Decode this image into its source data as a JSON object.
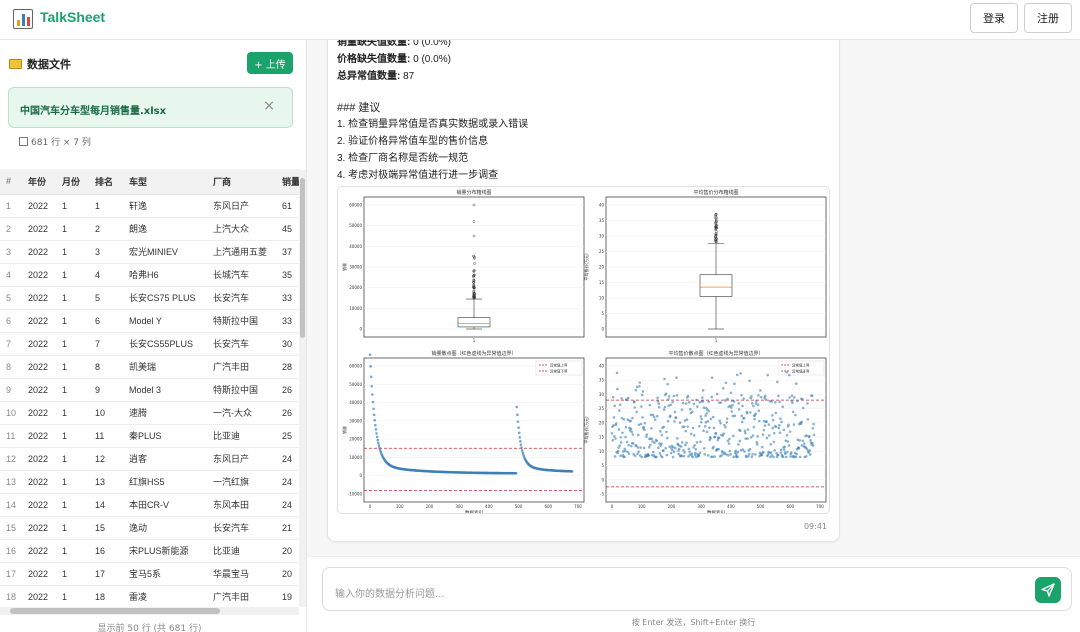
{
  "header": {
    "title": "TalkSheet",
    "login_label": "登录",
    "register_label": "注册",
    "brand_color": "#1aa36b"
  },
  "sidebar": {
    "heading": "数据文件",
    "upload_label": "+ 上传",
    "file": {
      "name": "中国汽车分车型每月销售量.xlsx",
      "close_icon": "×"
    },
    "rows_info": "681 行 × 7 列",
    "table": {
      "columns": [
        "#",
        "年份",
        "月份",
        "排名",
        "车型",
        "厂商",
        "销量"
      ],
      "rows": [
        [
          "1",
          "2022",
          "1",
          "1",
          "轩逸",
          "东风日产",
          "61"
        ],
        [
          "2",
          "2022",
          "1",
          "2",
          "朗逸",
          "上汽大众",
          "45"
        ],
        [
          "3",
          "2022",
          "1",
          "3",
          "宏光MINIEV",
          "上汽通用五菱",
          "37"
        ],
        [
          "4",
          "2022",
          "1",
          "4",
          "哈弗H6",
          "长城汽车",
          "35"
        ],
        [
          "5",
          "2022",
          "1",
          "5",
          "长安CS75 PLUS",
          "长安汽车",
          "33"
        ],
        [
          "6",
          "2022",
          "1",
          "6",
          "Model Y",
          "特斯拉中国",
          "33"
        ],
        [
          "7",
          "2022",
          "1",
          "7",
          "长安CS55PLUS",
          "长安汽车",
          "30"
        ],
        [
          "8",
          "2022",
          "1",
          "8",
          "凯美瑞",
          "广汽丰田",
          "28"
        ],
        [
          "9",
          "2022",
          "1",
          "9",
          "Model 3",
          "特斯拉中国",
          "26"
        ],
        [
          "10",
          "2022",
          "1",
          "10",
          "速腾",
          "一汽-大众",
          "26"
        ],
        [
          "11",
          "2022",
          "1",
          "11",
          "秦PLUS",
          "比亚迪",
          "25"
        ],
        [
          "12",
          "2022",
          "1",
          "12",
          "逍客",
          "东风日产",
          "24"
        ],
        [
          "13",
          "2022",
          "1",
          "13",
          "红旗HS5",
          "一汽红旗",
          "24"
        ],
        [
          "14",
          "2022",
          "1",
          "14",
          "本田CR-V",
          "东风本田",
          "24"
        ],
        [
          "15",
          "2022",
          "1",
          "15",
          "逸动",
          "长安汽车",
          "21"
        ],
        [
          "16",
          "2022",
          "1",
          "16",
          "宋PLUS新能源",
          "比亚迪",
          "20"
        ],
        [
          "17",
          "2022",
          "1",
          "17",
          "宝马5系",
          "华晨宝马",
          "20"
        ],
        [
          "18",
          "2022",
          "1",
          "18",
          "雷凌",
          "广汽丰田",
          "19"
        ]
      ]
    },
    "footer": "显示前 50 行 (共 681 行)"
  },
  "message": {
    "lines": [
      {
        "b": "销量缺失值数量:",
        "t": " 0 (0.0%)"
      },
      {
        "b": "价格缺失值数量:",
        "t": " 0 (0.0%)"
      },
      {
        "b": "总异常值数量:",
        "t": " 87"
      },
      {
        "b": "",
        "t": ""
      },
      {
        "b": "",
        "t": "### 建议"
      },
      {
        "b": "",
        "t": "1. 检查销量异常值是否真实数据或录入错误"
      },
      {
        "b": "",
        "t": "2. 验证价格异常值车型的售价信息"
      },
      {
        "b": "",
        "t": "3. 检查厂商名称是否统一规范"
      },
      {
        "b": "",
        "t": "4. 考虑对极端异常值进行进一步调查"
      }
    ],
    "time": "09:41"
  },
  "figure": {
    "panels": [
      {
        "title": "销量分布箱线图",
        "ylabel": "销量",
        "y_ticks": [
          "0",
          "10000",
          "20000",
          "30000",
          "40000",
          "50000",
          "60000"
        ],
        "x_ticks": [
          "1"
        ]
      },
      {
        "title": "平均售价分布箱线图",
        "ylabel": "平均售价(万元)",
        "y_ticks": [
          "0",
          "5",
          "10",
          "15",
          "20",
          "25",
          "30",
          "35",
          "40"
        ],
        "x_ticks": [
          "1"
        ]
      },
      {
        "title": "销量散点图（红色虚线为异常值边界）",
        "ylabel": "销量",
        "xlabel": "数据索引",
        "y_ticks": [
          "-10000",
          "0",
          "10000",
          "20000",
          "30000",
          "40000",
          "50000",
          "60000"
        ],
        "x_ticks": [
          "0",
          "100",
          "200",
          "300",
          "400",
          "500",
          "600",
          "700"
        ],
        "legend": [
          "异常值上界",
          "异常值下界"
        ]
      },
      {
        "title": "平均售价散点图（红色虚线为异常值边界）",
        "ylabel": "平均售价(万元)",
        "xlabel": "数据索引",
        "y_ticks": [
          "-5",
          "0",
          "5",
          "10",
          "15",
          "20",
          "25",
          "30",
          "35",
          "40"
        ],
        "x_ticks": [
          "0",
          "100",
          "200",
          "300",
          "400",
          "500",
          "600",
          "700"
        ],
        "legend": [
          "异常值上界",
          "异常值下界"
        ]
      }
    ],
    "point_color": "#3a7fb6",
    "bound_color": "#d62728"
  },
  "input": {
    "placeholder": "输入你的数据分析问题...",
    "hint": "按 Enter 发送，Shift+Enter 换行"
  }
}
